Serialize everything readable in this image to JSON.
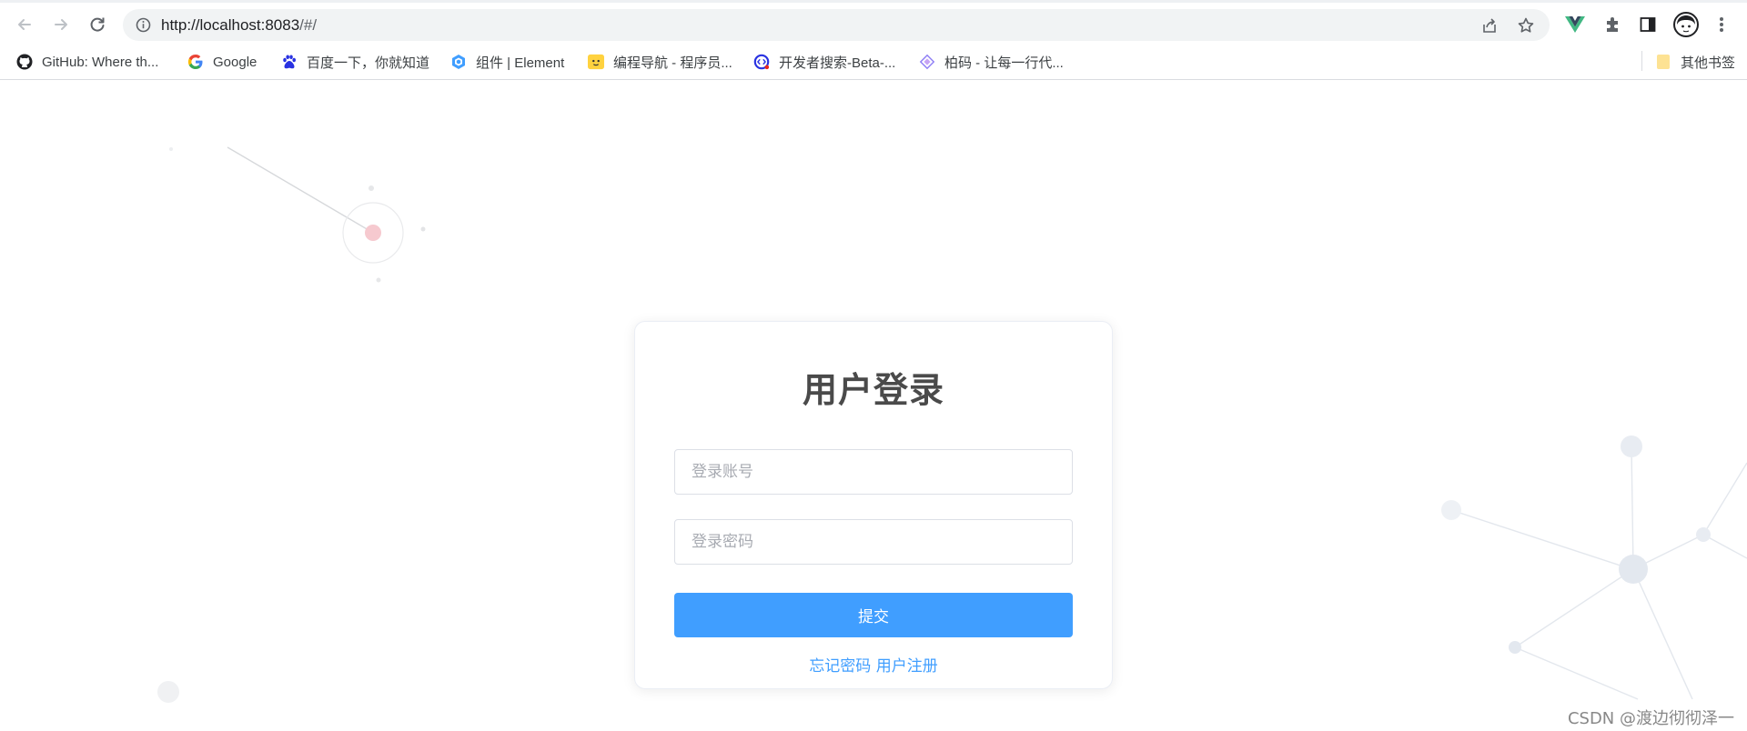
{
  "browser": {
    "url_host": "http://localhost:8083",
    "url_path": "/#/",
    "bookmarks": [
      {
        "label": "GitHub: Where th...",
        "icon": "github-icon"
      },
      {
        "label": "Google",
        "icon": "google-icon"
      },
      {
        "label": "百度一下，你就知道",
        "icon": "baidu-icon"
      },
      {
        "label": "组件 | Element",
        "icon": "element-icon"
      },
      {
        "label": "编程导航 - 程序员...",
        "icon": "programming-nav-icon"
      },
      {
        "label": "开发者搜索-Beta-...",
        "icon": "dev-search-icon"
      },
      {
        "label": "柏码 - 让每一行代...",
        "icon": "itbaima-icon"
      }
    ],
    "other_bookmarks": "其他书签"
  },
  "login": {
    "title": "用户登录",
    "username_placeholder": "登录账号",
    "password_placeholder": "登录密码",
    "submit_label": "提交",
    "forgot_password": "忘记密码",
    "register": "用户注册"
  },
  "watermark": "CSDN @渡边彻彻泽一",
  "colors": {
    "primary": "#409eff",
    "title": "#4a4a4a",
    "placeholder": "#a8abb2",
    "border": "#dcdfe6"
  }
}
